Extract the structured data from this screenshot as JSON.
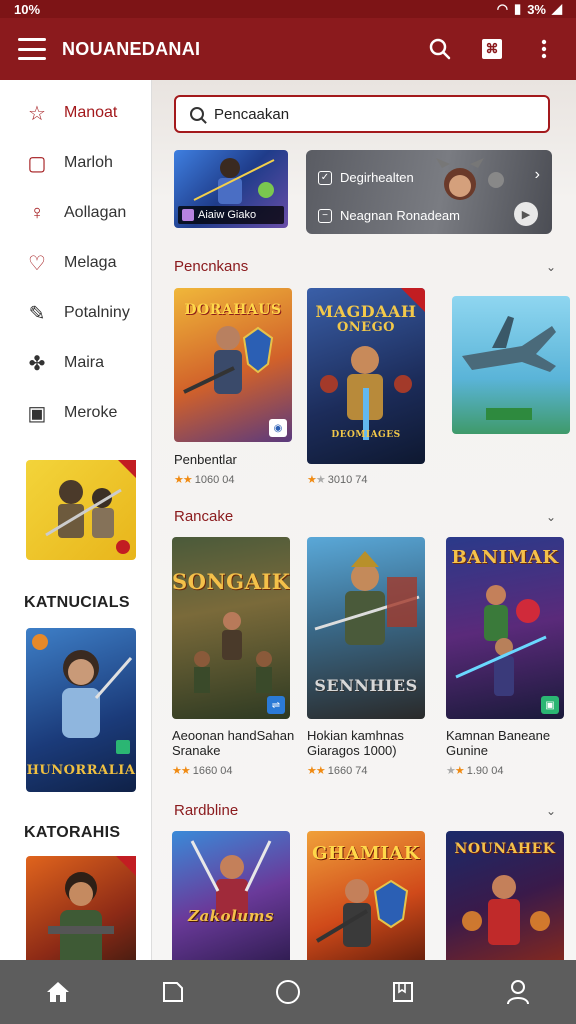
{
  "status": {
    "time": "10%",
    "right": "3%"
  },
  "appbar": {
    "title": "NOUANEDANAI",
    "icons": [
      "menu-icon",
      "search-icon",
      "bookmark-icon",
      "more-icon"
    ]
  },
  "sidebar": {
    "items": [
      {
        "label": "Manoat",
        "icon": "star-icon",
        "active": true
      },
      {
        "label": "Marloh",
        "icon": "square-icon"
      },
      {
        "label": "Aollagan",
        "icon": "person-icon"
      },
      {
        "label": "Melaga",
        "icon": "heart-icon"
      },
      {
        "label": "Potalniny",
        "icon": "tag-icon"
      },
      {
        "label": "Maira",
        "icon": "puzzle-icon"
      },
      {
        "label": "Meroke",
        "icon": "inbox-icon"
      }
    ],
    "section1": "KATNUCIALS",
    "section2": "KATORAHIS",
    "card1_text": "HUNORRALIA"
  },
  "search": {
    "placeholder": "Pencaakan"
  },
  "promo": {
    "small_caption": "Aiaiw  Giako",
    "big_row1": "Degirhealten",
    "big_row2": "Neagnan Ronadeam"
  },
  "sections": [
    {
      "title": "Pencnkans",
      "cards": [
        {
          "art": "DORAHAUS",
          "caption": "Penbentlar",
          "rating": "1060 04",
          "stars": 2
        },
        {
          "art": "MAGDAAH",
          "art2": "ONEGO",
          "art3": "DEOMIAGES",
          "caption": "",
          "rating": "3010 74",
          "stars": 1
        },
        {
          "art": "",
          "caption": "",
          "rating": "",
          "stars": 0
        }
      ]
    },
    {
      "title": "Rancake",
      "cards": [
        {
          "art": "SONGAIK",
          "caption": "Aeoonan handSahan\nSranake",
          "rating": "1660 04",
          "stars": 2
        },
        {
          "art": "SENNHIES",
          "caption": "Hokian kamhnas\nGiaragos 1000)",
          "rating": "1660 74",
          "stars": 2
        },
        {
          "art": "BANIMAK",
          "caption": "Kamnan Baneane\nGunine",
          "rating": "1.90 04",
          "stars": 1
        }
      ]
    },
    {
      "title": "Rardbline",
      "cards": [
        {
          "art": "Zakolums"
        },
        {
          "art": "GHAMIAK"
        },
        {
          "art": "NOUNAHEK"
        }
      ]
    }
  ],
  "nav": [
    "home-icon",
    "square-nav-icon",
    "circle-nav-icon",
    "library-icon",
    "profile-icon"
  ]
}
